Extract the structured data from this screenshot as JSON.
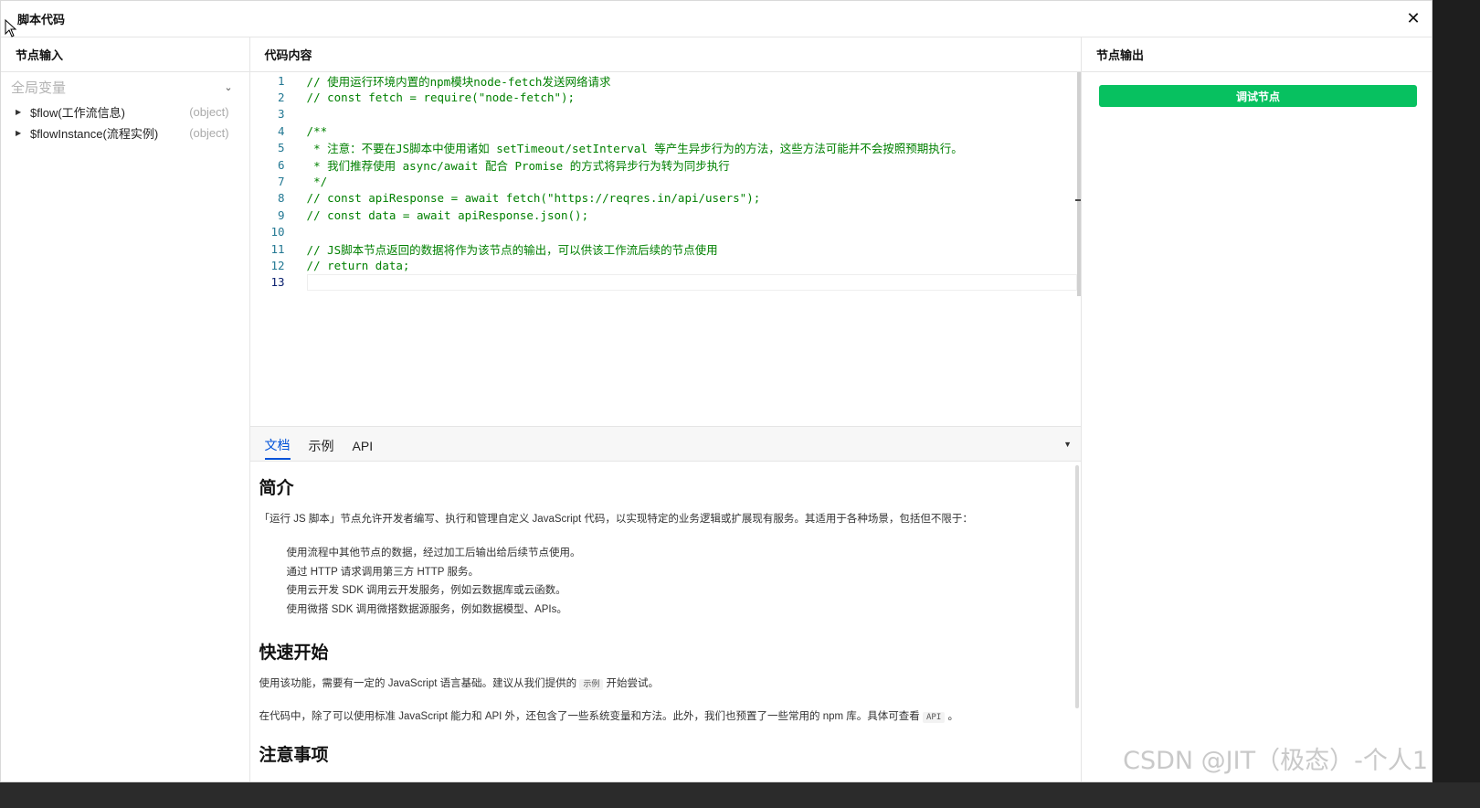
{
  "dialog": {
    "title": "脚本代码",
    "close_icon": "✕"
  },
  "left": {
    "header": "节点输入",
    "group_label": "全局变量",
    "variables": [
      {
        "name": "$flow(工作流信息)",
        "type": "(object)"
      },
      {
        "name": "$flowInstance(流程实例)",
        "type": "(object)"
      }
    ]
  },
  "middle": {
    "header": "代码内容",
    "code_lines": [
      {
        "n": "1",
        "text": "// 使用运行环境内置的npm模块node-fetch发送网络请求"
      },
      {
        "n": "2",
        "text": "// const fetch = require(\"node-fetch\");"
      },
      {
        "n": "3",
        "text": ""
      },
      {
        "n": "4",
        "text": "/**"
      },
      {
        "n": "5",
        "text": " * 注意：不要在JS脚本中使用诸如 setTimeout/setInterval 等产生异步行为的方法，这些方法可能并不会按照预期执行。"
      },
      {
        "n": "6",
        "text": " * 我们推荐使用 async/await 配合 Promise 的方式将异步行为转为同步执行"
      },
      {
        "n": "7",
        "text": " */"
      },
      {
        "n": "8",
        "text": "// const apiResponse = await fetch(\"https://reqres.in/api/users\");"
      },
      {
        "n": "9",
        "text": "// const data = await apiResponse.json();"
      },
      {
        "n": "10",
        "text": ""
      },
      {
        "n": "11",
        "text": "// JS脚本节点返回的数据将作为该节点的输出，可以供该工作流后续的节点使用"
      },
      {
        "n": "12",
        "text": "// return data;"
      },
      {
        "n": "13",
        "text": ""
      }
    ],
    "tabs": [
      "文档",
      "示例",
      "API"
    ],
    "doc": {
      "h_intro": "简介",
      "intro": "「运行 JS 脚本」节点允许开发者编写、执行和管理自定义 JavaScript 代码，以实现特定的业务逻辑或扩展现有服务。其适用于各种场景，包括但不限于：",
      "list": [
        "使用流程中其他节点的数据，经过加工后输出给后续节点使用。",
        "通过 HTTP 请求调用第三方 HTTP 服务。",
        "使用云开发 SDK 调用云开发服务，例如云数据库或云函数。",
        "使用微搭 SDK 调用微搭数据源服务，例如数据模型、APIs。"
      ],
      "h_quick": "快速开始",
      "quick_p1_a": "使用该功能，需要有一定的 JavaScript 语言基础。建议从我们提供的",
      "quick_p1_tag": "示例",
      "quick_p1_b": "开始尝试。",
      "quick_p2_a": "在代码中，除了可以使用标准 JavaScript 能力和 API 外，还包含了一些系统变量和方法。此外，我们也预置了一些常用的 npm 库。具体可查看",
      "quick_p2_tag": "API",
      "quick_p2_b": "。",
      "h_notes": "注意事项"
    }
  },
  "right": {
    "header": "节点输出",
    "debug_button": "调试节点"
  },
  "watermark": "CSDN @JIT（极态）-个人1",
  "colors": {
    "accent": "#0052d9",
    "debug": "#07c160",
    "code_comment": "#008000"
  }
}
